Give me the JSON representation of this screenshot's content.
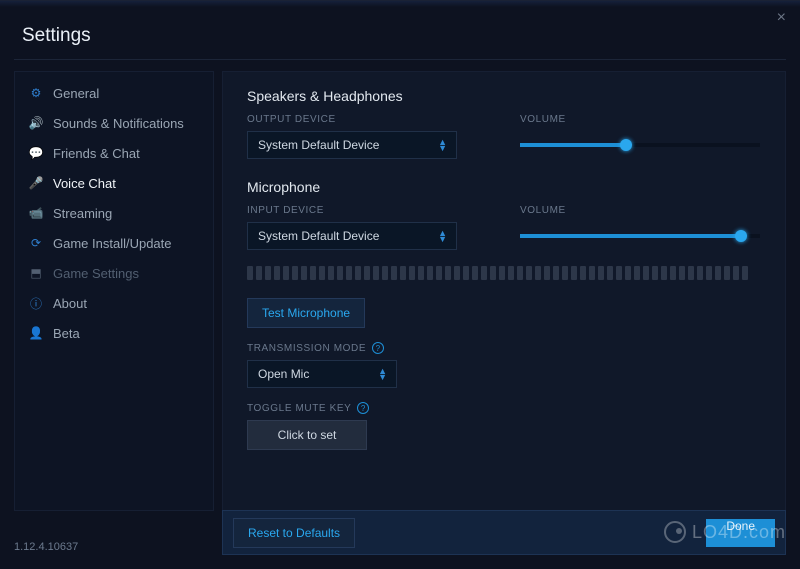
{
  "window": {
    "title": "Settings",
    "version": "1.12.4.10637"
  },
  "sidebar": {
    "items": [
      {
        "label": "General",
        "icon": "⚙"
      },
      {
        "label": "Sounds & Notifications",
        "icon": "🔊"
      },
      {
        "label": "Friends & Chat",
        "icon": "💬"
      },
      {
        "label": "Voice Chat",
        "icon": "🎤"
      },
      {
        "label": "Streaming",
        "icon": "📹"
      },
      {
        "label": "Game Install/Update",
        "icon": "⟳"
      },
      {
        "label": "Game Settings",
        "icon": "⬒"
      },
      {
        "label": "About",
        "icon": "ⓘ"
      },
      {
        "label": "Beta",
        "icon": "👤"
      }
    ]
  },
  "speakers": {
    "section_title": "Speakers & Headphones",
    "output_label": "OUTPUT DEVICE",
    "output_value": "System Default Device",
    "volume_label": "VOLUME",
    "volume_percent": 44
  },
  "microphone": {
    "section_title": "Microphone",
    "input_label": "INPUT DEVICE",
    "input_value": "System Default Device",
    "volume_label": "VOLUME",
    "volume_percent": 92,
    "test_button": "Test Microphone",
    "transmission_label": "TRANSMISSION MODE",
    "transmission_value": "Open Mic",
    "toggle_mute_label": "TOGGLE MUTE KEY",
    "toggle_mute_value": "Click to set"
  },
  "footer": {
    "reset": "Reset to Defaults",
    "done": "Done"
  },
  "watermark": "LO4D.com"
}
